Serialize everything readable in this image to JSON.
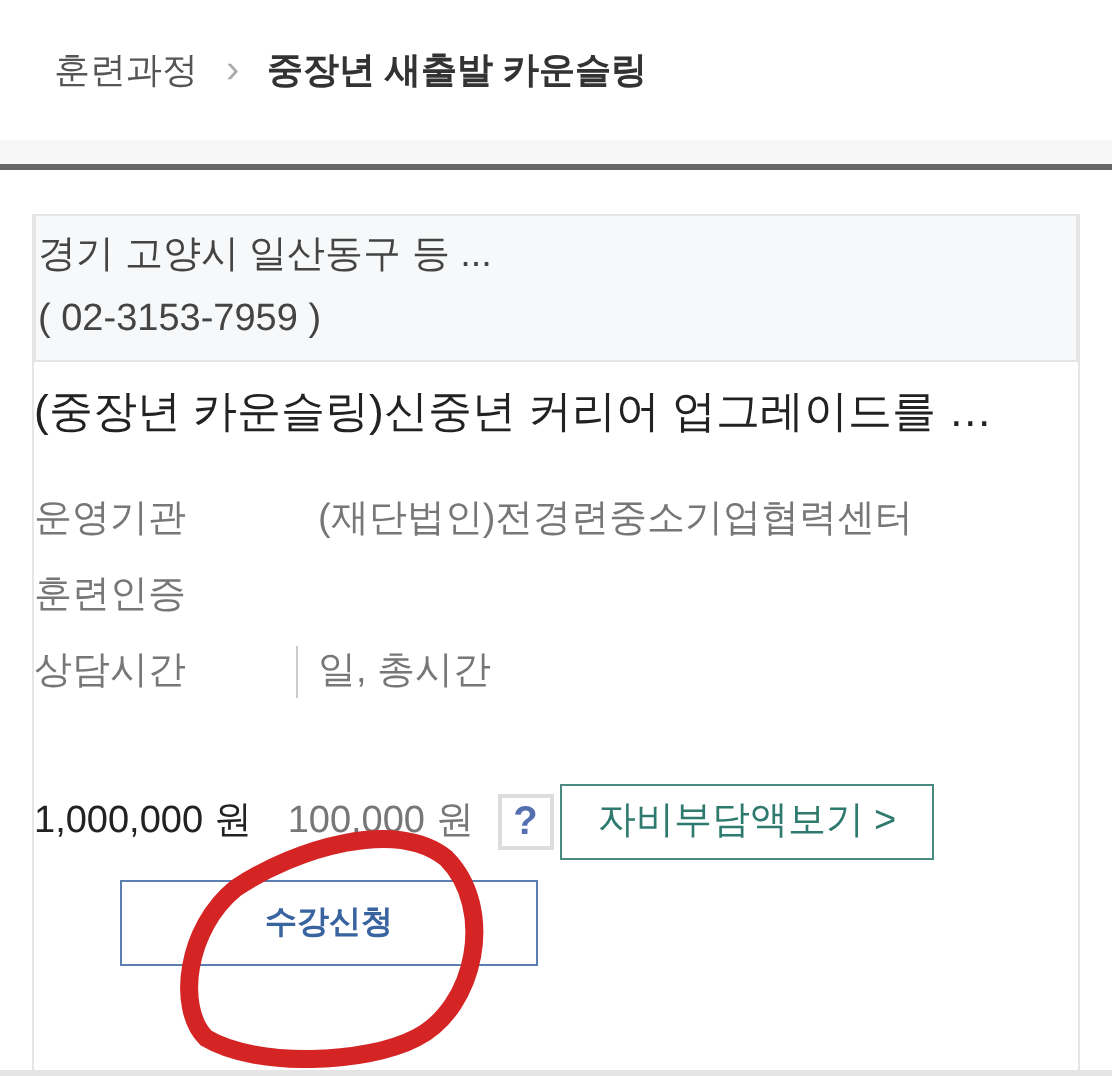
{
  "breadcrumb": {
    "parent": "훈련과정",
    "separator": "›",
    "current": "중장년 새출발 카운슬링"
  },
  "card": {
    "address": "경기 고양시 일산동구 등 ...",
    "phone": "( 02-3153-7959 )",
    "title": "(중장년 카운슬링)신중년 커리어 업그레이드를 …",
    "rows": [
      {
        "label": "운영기관",
        "value": "(재단법인)전경련중소기업협력센터",
        "divider": false
      },
      {
        "label": "훈련인증",
        "divider": false
      },
      {
        "label": "상담시간",
        "value": "일, 총시간",
        "divider": true
      }
    ],
    "price": "1,000,000 원",
    "self_pay": "100,000 원",
    "help": "?",
    "self_pay_button": "자비부담액보기 >",
    "apply_button": "수강신청"
  },
  "annotation": {
    "kind": "circle"
  }
}
